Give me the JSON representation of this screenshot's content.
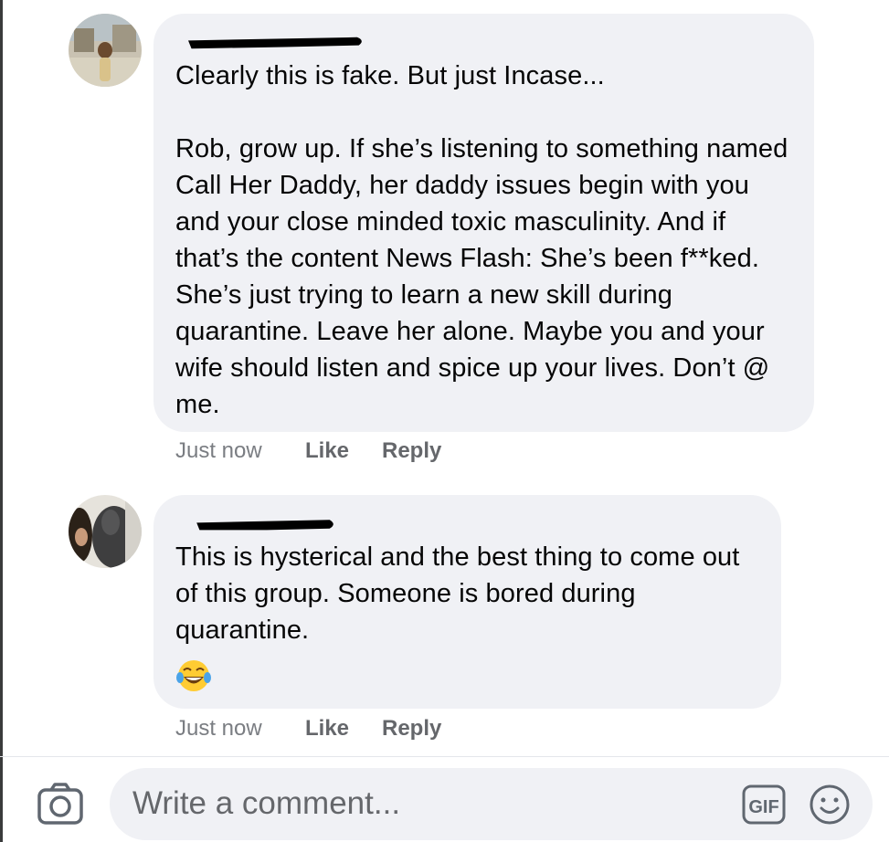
{
  "comments": [
    {
      "author_redacted": true,
      "text": "Clearly this is fake. But just Incase...\n\nRob, grow up. If she’s listening to something named Call Her Daddy, her daddy issues begin with you and your close minded toxic masculinity. And if that’s the content News Flash: She’s been f**ked. She’s just trying to learn a new skill during quarantine. Leave her alone. Maybe you and your wife should listen and spice up your lives. Don’t @ me.",
      "time": "Just now",
      "like_label": "Like",
      "reply_label": "Reply"
    },
    {
      "author_redacted": true,
      "text": "This is hysterical and the best thing to come out of this group. Someone is bored during quarantine.",
      "emoji": "face-with-tears-of-joy",
      "time": "Just now",
      "like_label": "Like",
      "reply_label": "Reply"
    }
  ],
  "composer": {
    "placeholder": "Write a comment...",
    "camera_icon": "camera-icon",
    "gif_icon": "gif-icon",
    "emoji_icon": "smiley-icon"
  },
  "colors": {
    "bubble": "#f0f1f5",
    "text": "#050505",
    "meta": "#65676b"
  }
}
